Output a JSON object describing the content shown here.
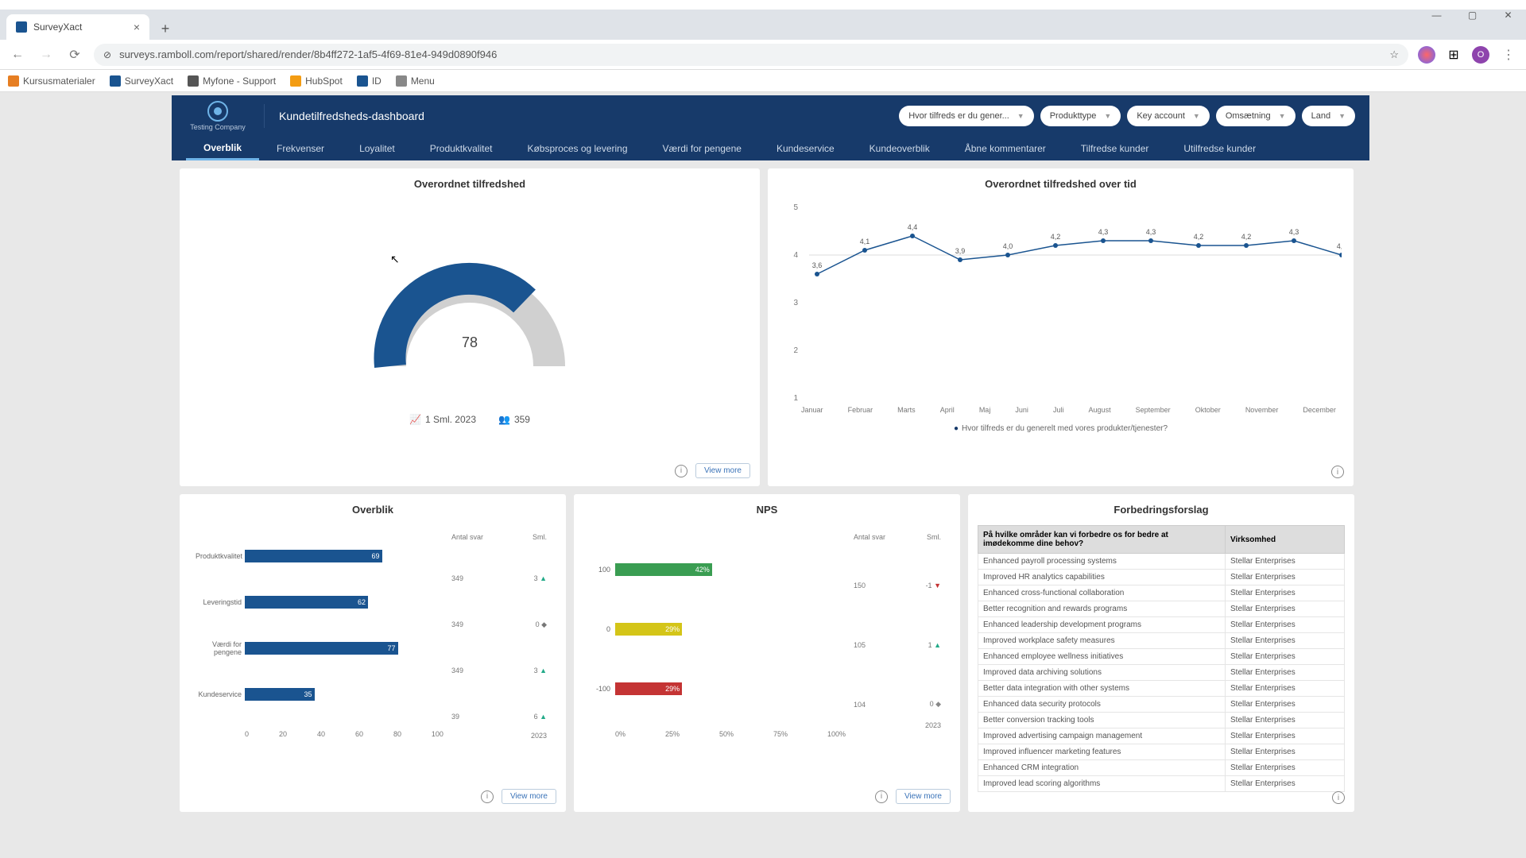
{
  "browser": {
    "tab": "SurveyXact",
    "url": "surveys.ramboll.com/report/shared/render/8b4ff272-1af5-4f69-81e4-949d0890f946",
    "bookmarks": [
      "Kursusmaterialer",
      "SurveyXact",
      "Myfone - Support",
      "HubSpot",
      "ID",
      "Menu"
    ]
  },
  "header": {
    "logo": "Testing Company",
    "title": "Kundetilfredsheds-dashboard",
    "filters": [
      "Hvor tilfreds er du gener...",
      "Produkttype",
      "Key account",
      "Omsætning",
      "Land"
    ]
  },
  "tabs": [
    "Overblik",
    "Frekvenser",
    "Loyalitet",
    "Produktkvalitet",
    "Købsproces og levering",
    "Værdi for pengene",
    "Kundeservice",
    "Kundeoverblik",
    "Åbne kommentarer",
    "Tilfredse kunder",
    "Utilfredse kunder"
  ],
  "gauge": {
    "title": "Overordnet tilfredshed",
    "value": "78",
    "stat1": "1 Sml. 2023",
    "stat2": "359"
  },
  "view_more": "View more",
  "line": {
    "title": "Overordnet tilfredshed over tid",
    "legend": "Hvor tilfreds er du generelt med vores produkter/tjenester?",
    "xlabels": [
      "Januar",
      "Februar",
      "Marts",
      "April",
      "Maj",
      "Juni",
      "Juli",
      "August",
      "September",
      "Oktober",
      "November",
      "December"
    ],
    "yticks": [
      "5",
      "4",
      "3",
      "2",
      "1"
    ]
  },
  "overblik": {
    "title": "Overblik",
    "h1": "Antal svar",
    "h2": "Sml.",
    "rows": [
      {
        "label": "Produktkvalitet",
        "val": "69",
        "n": "349",
        "d": "3",
        "dir": "up"
      },
      {
        "label": "Leveringstid",
        "val": "62",
        "n": "349",
        "d": "0",
        "dir": "flat"
      },
      {
        "label": "Værdi for pengene",
        "val": "77",
        "n": "349",
        "d": "3",
        "dir": "up"
      },
      {
        "label": "Kundeservice",
        "val": "35",
        "n": "39",
        "d": "6",
        "dir": "up"
      }
    ],
    "xticks": [
      "0",
      "20",
      "40",
      "60",
      "80",
      "100"
    ],
    "yr": "2023"
  },
  "nps": {
    "title": "NPS",
    "h1": "Antal svar",
    "h2": "Sml.",
    "rows": [
      {
        "label": "100",
        "val": "42%",
        "w": 42,
        "color": "#3a9d52",
        "n": "150",
        "d": "-1",
        "dir": "down"
      },
      {
        "label": "0",
        "val": "29%",
        "w": 29,
        "color": "#d4c518",
        "n": "105",
        "d": "1",
        "dir": "up"
      },
      {
        "label": "-100",
        "val": "29%",
        "w": 29,
        "color": "#c43434",
        "n": "104",
        "d": "0",
        "dir": "flat"
      }
    ],
    "xticks": [
      "0%",
      "25%",
      "50%",
      "75%",
      "100%"
    ],
    "yr": "2023"
  },
  "sugg": {
    "title": "Forbedringsforslag",
    "h1": "På hvilke områder kan vi forbedre os for bedre at imødekomme dine behov?",
    "h2": "Virksomhed",
    "rows": [
      [
        "Enhanced payroll processing systems",
        "Stellar Enterprises"
      ],
      [
        "Improved HR analytics capabilities",
        "Stellar Enterprises"
      ],
      [
        "Enhanced cross-functional collaboration",
        "Stellar Enterprises"
      ],
      [
        "Better recognition and rewards programs",
        "Stellar Enterprises"
      ],
      [
        "Enhanced leadership development programs",
        "Stellar Enterprises"
      ],
      [
        "Improved workplace safety measures",
        "Stellar Enterprises"
      ],
      [
        "Enhanced employee wellness initiatives",
        "Stellar Enterprises"
      ],
      [
        "Improved data archiving solutions",
        "Stellar Enterprises"
      ],
      [
        "Better data integration with other systems",
        "Stellar Enterprises"
      ],
      [
        "Enhanced data security protocols",
        "Stellar Enterprises"
      ],
      [
        "Better conversion tracking tools",
        "Stellar Enterprises"
      ],
      [
        "Improved advertising campaign management",
        "Stellar Enterprises"
      ],
      [
        "Improved influencer marketing features",
        "Stellar Enterprises"
      ],
      [
        "Enhanced CRM integration",
        "Stellar Enterprises"
      ],
      [
        "Improved lead scoring algorithms",
        "Stellar Enterprises"
      ]
    ]
  },
  "chart_data": [
    {
      "type": "gauge",
      "title": "Overordnet tilfredshed",
      "value": 78,
      "range": [
        0,
        100
      ]
    },
    {
      "type": "line",
      "title": "Overordnet tilfredshed over tid",
      "x": [
        "Januar",
        "Februar",
        "Marts",
        "April",
        "Maj",
        "Juni",
        "Juli",
        "August",
        "September",
        "Oktober",
        "November",
        "December"
      ],
      "series": [
        {
          "name": "Hvor tilfreds er du generelt med vores produkter/tjenester?",
          "values": [
            3.6,
            4.1,
            4.4,
            3.9,
            4.0,
            4.2,
            4.3,
            4.3,
            4.2,
            4.2,
            4.3,
            4.0
          ]
        }
      ],
      "ylim": [
        1,
        5
      ]
    },
    {
      "type": "bar",
      "title": "Overblik",
      "orientation": "horizontal",
      "categories": [
        "Produktkvalitet",
        "Leveringstid",
        "Værdi for pengene",
        "Kundeservice"
      ],
      "values": [
        69,
        62,
        77,
        35
      ],
      "xlim": [
        0,
        100
      ],
      "meta": {
        "Antal svar": [
          349,
          349,
          349,
          39
        ],
        "Sml.": [
          3,
          0,
          3,
          6
        ]
      }
    },
    {
      "type": "bar",
      "title": "NPS",
      "orientation": "horizontal",
      "categories": [
        "100",
        "0",
        "-100"
      ],
      "values": [
        42,
        29,
        29
      ],
      "unit": "%",
      "xlim": [
        0,
        100
      ],
      "colors": [
        "#3a9d52",
        "#d4c518",
        "#c43434"
      ],
      "meta": {
        "Antal svar": [
          150,
          105,
          104
        ],
        "Sml.": [
          -1,
          1,
          0
        ]
      }
    }
  ]
}
